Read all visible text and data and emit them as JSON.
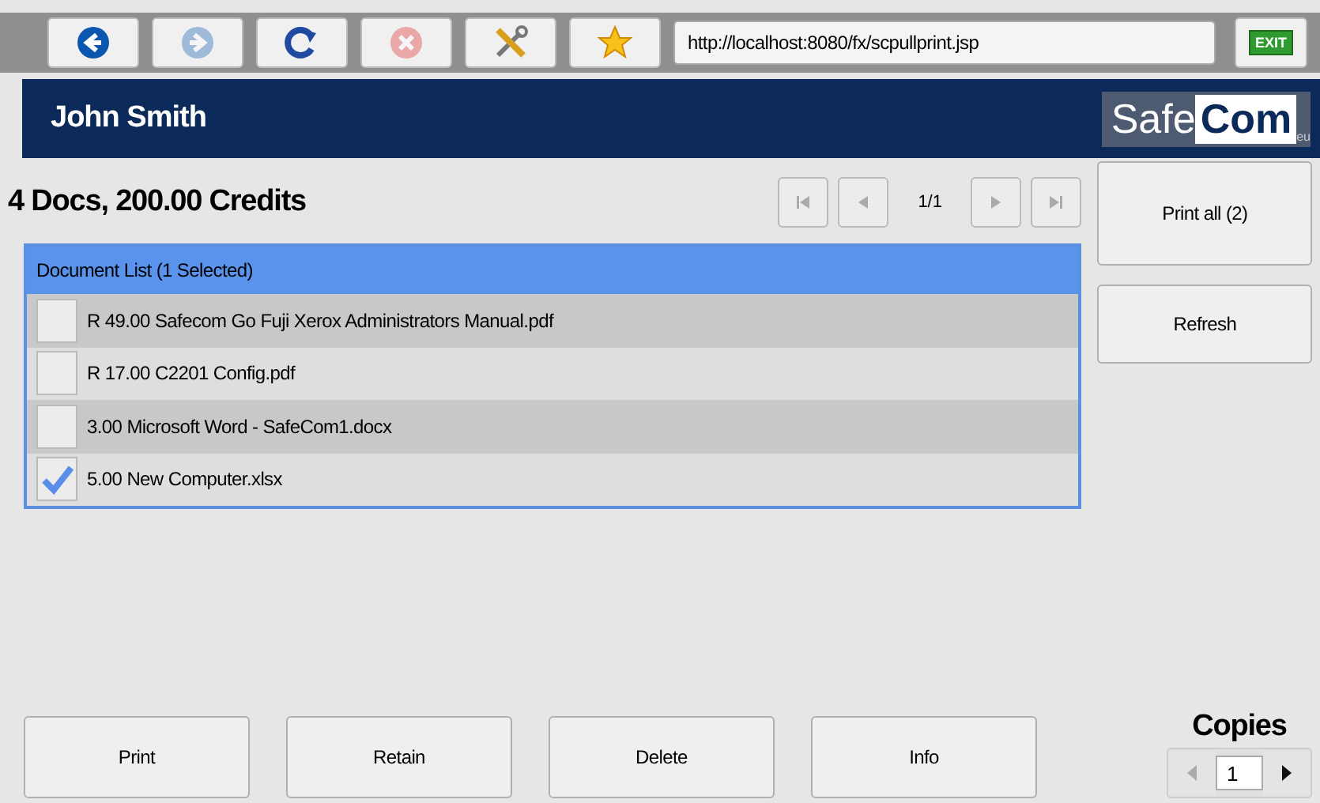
{
  "browser_toolbar": {
    "buttons": [
      {
        "kind": "back",
        "disabled": false
      },
      {
        "kind": "forward",
        "disabled": true
      },
      {
        "kind": "reload",
        "disabled": false
      },
      {
        "kind": "stop",
        "disabled": true
      },
      {
        "kind": "tools",
        "disabled": false
      },
      {
        "kind": "favorite",
        "disabled": false
      }
    ],
    "address": "http://localhost:8080/fx/scpullprint.jsp",
    "exit_label": "EXIT"
  },
  "header": {
    "user_name": "John Smith",
    "logo_left": "Safe",
    "logo_right": "Com",
    "logo_suffix": "eu"
  },
  "summary": "4 Docs, 200.00 Credits",
  "pager": {
    "buttons": [
      {
        "kind": "first",
        "disabled": true
      },
      {
        "kind": "prev",
        "disabled": true
      },
      {
        "kind": "next",
        "disabled": true
      },
      {
        "kind": "last",
        "disabled": true
      }
    ],
    "page": "1/1"
  },
  "document_list": {
    "title": "Document List (1 Selected)",
    "rows": [
      {
        "label": "R 49.00 Safecom Go Fuji Xerox Administrators Manual.pdf",
        "selected": false
      },
      {
        "label": "R 17.00 C2201 Config.pdf",
        "selected": false
      },
      {
        "label": "3.00 Microsoft Word - SafeCom1.docx",
        "selected": false
      },
      {
        "label": "5.00 New Computer.xlsx",
        "selected": true
      }
    ]
  },
  "side_buttons": [
    "Print all (2)",
    "Refresh"
  ],
  "action_buttons": [
    "Print",
    "Retain",
    "Delete",
    "Info"
  ],
  "copies": {
    "label": "Copies",
    "value": "1",
    "decrement_disabled": true,
    "increment_disabled": false
  }
}
